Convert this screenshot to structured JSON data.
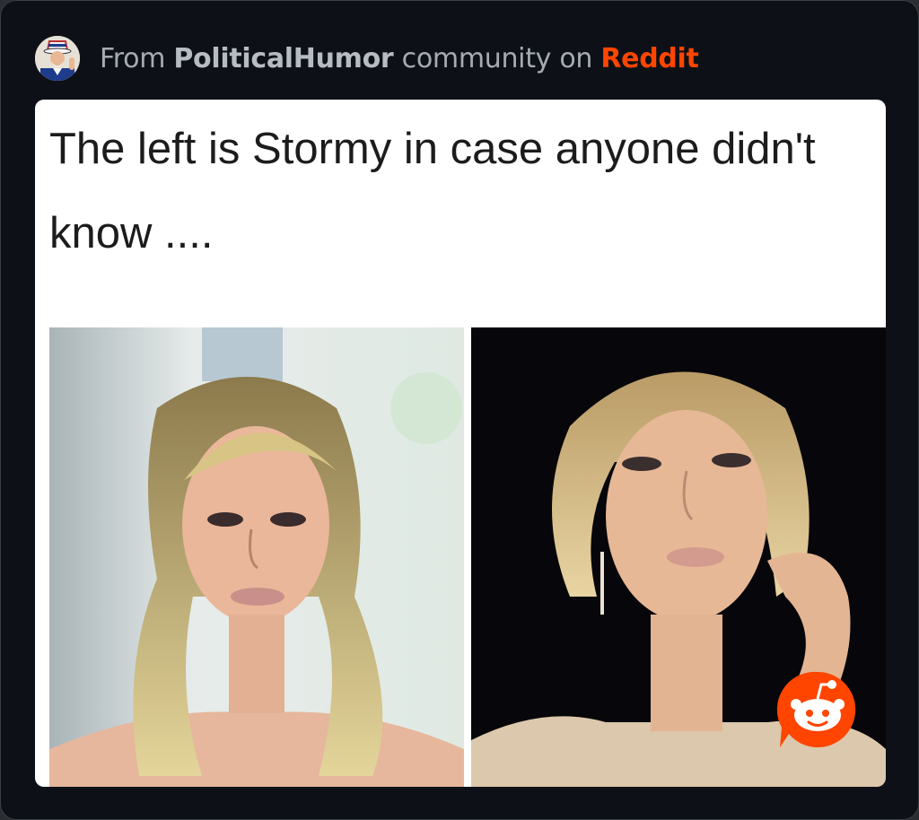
{
  "header": {
    "prefix": "From ",
    "community": "PoliticalHumor",
    "middle": " community on ",
    "platform": "Reddit"
  },
  "post": {
    "caption": "The left is Stormy in case anyone didn't know ...."
  },
  "icons": {
    "avatar": "uncle-sam-avatar-icon",
    "badge": "reddit-snoo-icon"
  },
  "colors": {
    "card_background": "#0d1117",
    "header_text": "#a6abb3",
    "brand_accent": "#ff4500",
    "post_background": "#ffffff",
    "caption_text": "#1c1c1c"
  }
}
